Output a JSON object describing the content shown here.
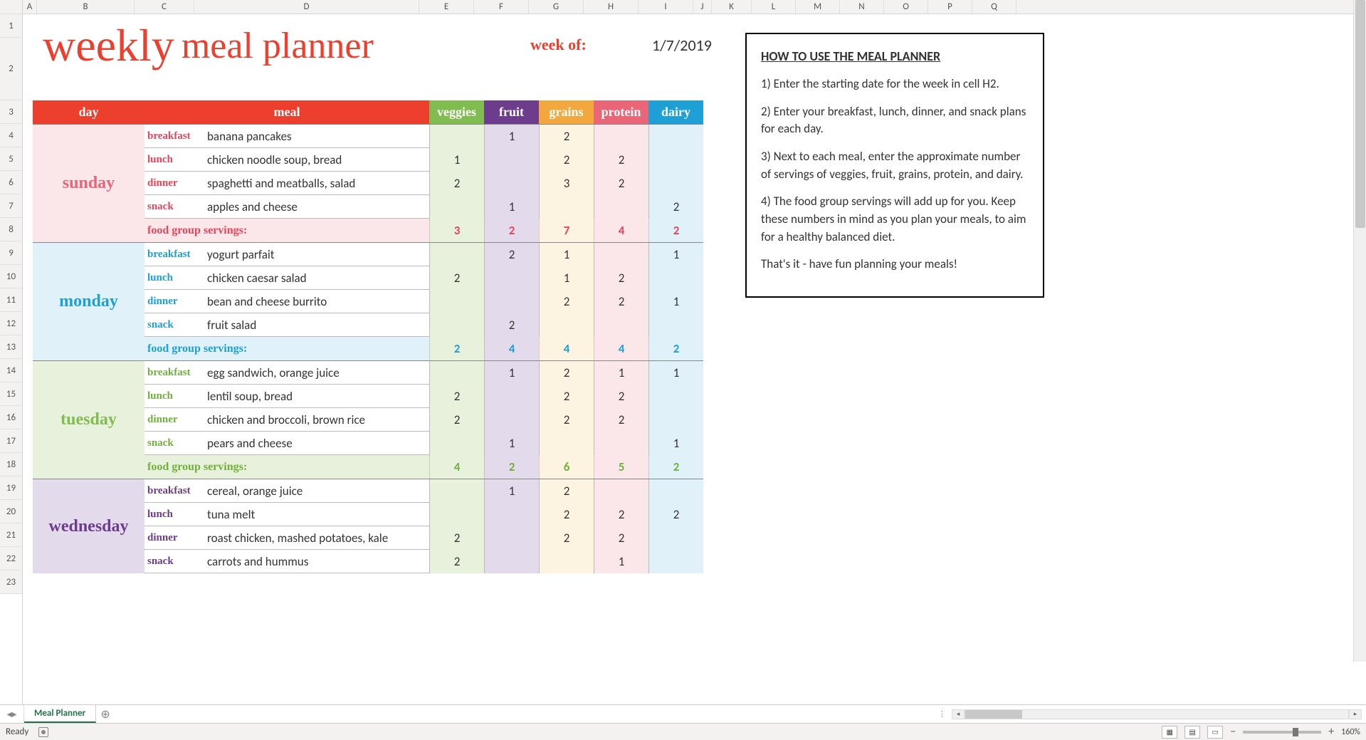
{
  "columns": [
    "A",
    "B",
    "C",
    "D",
    "E",
    "F",
    "G",
    "H",
    "I",
    "J",
    "K",
    "L",
    "M",
    "N",
    "O",
    "P",
    "Q"
  ],
  "rows": [
    "1",
    "2",
    "3",
    "4",
    "5",
    "6",
    "7",
    "8",
    "9",
    "10",
    "11",
    "12",
    "13",
    "14",
    "15",
    "16",
    "17",
    "18",
    "19",
    "20",
    "21",
    "22",
    "23"
  ],
  "title": {
    "weekly": "weekly",
    "mealplanner": "meal planner"
  },
  "weekof": {
    "label": "week of:",
    "date": "1/7/2019"
  },
  "headers": {
    "day": "day",
    "meal": "meal",
    "veggies": "veggies",
    "fruit": "fruit",
    "grains": "grains",
    "protein": "protein",
    "dairy": "dairy"
  },
  "meal_labels": {
    "breakfast": "breakfast",
    "lunch": "lunch",
    "dinner": "dinner",
    "snack": "snack",
    "totals": "food group servings:"
  },
  "days": [
    {
      "name": "sunday",
      "cls": "sunday",
      "meals": [
        {
          "k": "breakfast",
          "t": "banana pancakes",
          "v": [
            "",
            "1",
            "2",
            "",
            ""
          ]
        },
        {
          "k": "lunch",
          "t": "chicken noodle soup, bread",
          "v": [
            "1",
            "",
            "2",
            "2",
            ""
          ]
        },
        {
          "k": "dinner",
          "t": "spaghetti and meatballs, salad",
          "v": [
            "2",
            "",
            "3",
            "2",
            ""
          ]
        },
        {
          "k": "snack",
          "t": "apples and cheese",
          "v": [
            "",
            "1",
            "",
            "",
            "2"
          ]
        }
      ],
      "totals": [
        "3",
        "2",
        "7",
        "4",
        "2"
      ],
      "show_totals": true
    },
    {
      "name": "monday",
      "cls": "monday",
      "meals": [
        {
          "k": "breakfast",
          "t": "yogurt parfait",
          "v": [
            "",
            "2",
            "1",
            "",
            "1"
          ]
        },
        {
          "k": "lunch",
          "t": "chicken caesar salad",
          "v": [
            "2",
            "",
            "1",
            "2",
            ""
          ]
        },
        {
          "k": "dinner",
          "t": "bean and cheese burrito",
          "v": [
            "",
            "",
            "2",
            "2",
            "1"
          ]
        },
        {
          "k": "snack",
          "t": "fruit salad",
          "v": [
            "",
            "2",
            "",
            "",
            ""
          ]
        }
      ],
      "totals": [
        "2",
        "4",
        "4",
        "4",
        "2"
      ],
      "show_totals": true
    },
    {
      "name": "tuesday",
      "cls": "tuesday",
      "meals": [
        {
          "k": "breakfast",
          "t": "egg sandwich, orange juice",
          "v": [
            "",
            "1",
            "2",
            "1",
            "1"
          ]
        },
        {
          "k": "lunch",
          "t": "lentil soup, bread",
          "v": [
            "2",
            "",
            "2",
            "2",
            ""
          ]
        },
        {
          "k": "dinner",
          "t": "chicken and broccoli, brown rice",
          "v": [
            "2",
            "",
            "2",
            "2",
            ""
          ]
        },
        {
          "k": "snack",
          "t": "pears and cheese",
          "v": [
            "",
            "1",
            "",
            "",
            "1"
          ]
        }
      ],
      "totals": [
        "4",
        "2",
        "6",
        "5",
        "2"
      ],
      "show_totals": true
    },
    {
      "name": "wednesday",
      "cls": "wednesday",
      "meals": [
        {
          "k": "breakfast",
          "t": "cereal, orange juice",
          "v": [
            "",
            "1",
            "2",
            "",
            ""
          ]
        },
        {
          "k": "lunch",
          "t": "tuna melt",
          "v": [
            "",
            "",
            "2",
            "2",
            "2"
          ]
        },
        {
          "k": "dinner",
          "t": "roast chicken, mashed potatoes, kale",
          "v": [
            "2",
            "",
            "2",
            "2",
            ""
          ]
        },
        {
          "k": "snack",
          "t": "carrots and hummus",
          "v": [
            "2",
            "",
            "",
            "1",
            ""
          ]
        }
      ],
      "totals": [
        "",
        "",
        "",
        "",
        ""
      ],
      "show_totals": false
    }
  ],
  "instructions": {
    "title": "HOW TO USE THE MEAL PLANNER",
    "p1": "1)  Enter the starting date for the week in cell H2.",
    "p2": "2)  Enter your breakfast, lunch, dinner, and snack plans for each day.",
    "p3": "3)  Next to each meal, enter the approximate number of servings of veggies, fruit, grains, protein, and dairy.",
    "p4": "4)  The food group servings will add up for you.  Keep these numbers in mind as you plan your meals, to aim for a healthy balanced diet.",
    "p5": "That's it - have fun planning your meals!"
  },
  "sheet_tab": "Meal Planner",
  "status": {
    "ready": "Ready",
    "zoom": "160%"
  }
}
